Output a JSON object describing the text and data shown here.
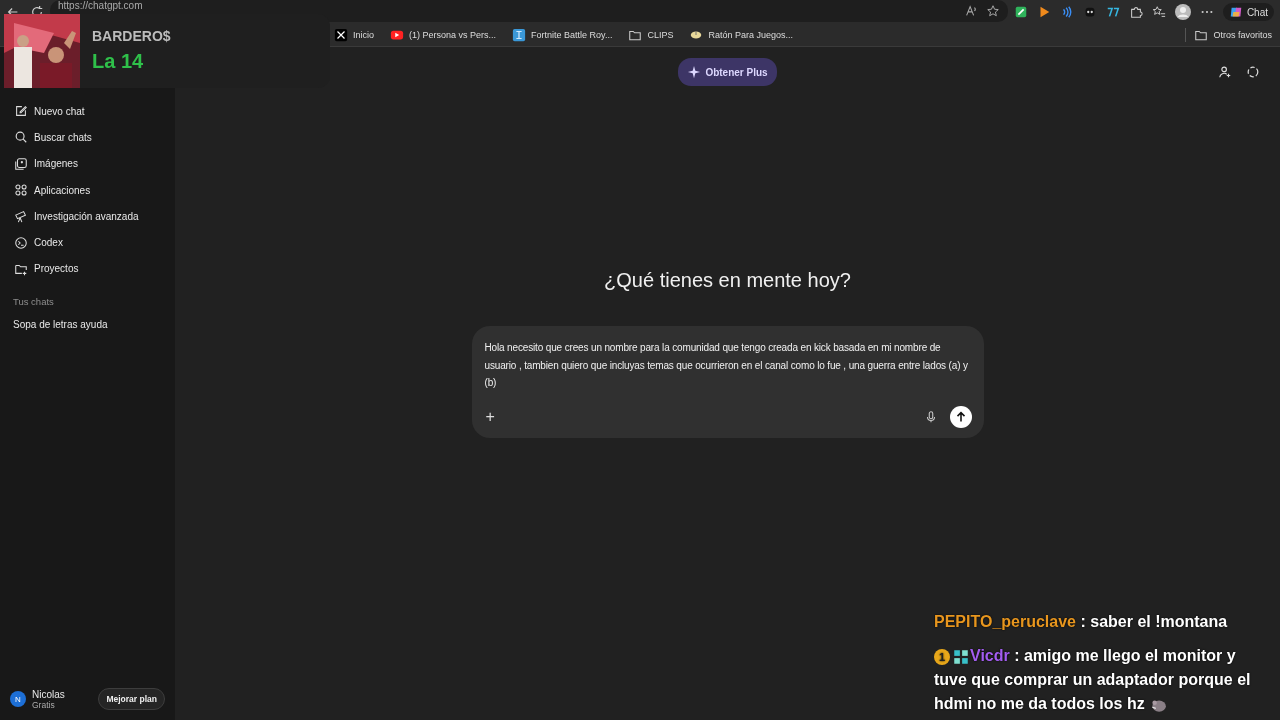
{
  "browser": {
    "url": "https://chatgpt.com",
    "copilot_label": "Chat",
    "bookmarks": [
      {
        "kind": "x",
        "label": "Inicio"
      },
      {
        "kind": "video",
        "label": "(1) Persona vs Pers..."
      },
      {
        "kind": "game",
        "label": "Fortnite Battle Roy..."
      },
      {
        "kind": "folder",
        "label": "CLIPS"
      },
      {
        "kind": "mouse",
        "label": "Ratón Para Juegos..."
      }
    ],
    "other_bookmarks": "Otros favoritos"
  },
  "stream_overlay": {
    "title": "BARDERO$",
    "subtitle": "La 14"
  },
  "sidebar": {
    "items": [
      {
        "kind": "edit",
        "label": "Nuevo chat"
      },
      {
        "kind": "search",
        "label": "Buscar chats"
      },
      {
        "kind": "images",
        "label": "Imágenes"
      },
      {
        "kind": "apps",
        "label": "Aplicaciones"
      },
      {
        "kind": "telescope",
        "label": "Investigación avanzada"
      },
      {
        "kind": "codex",
        "label": "Codex"
      },
      {
        "kind": "folder",
        "label": "Proyectos"
      }
    ],
    "section_title": "Tus chats",
    "chats": [
      {
        "label": "Sopa de letras ayuda"
      }
    ],
    "user": {
      "initial": "N",
      "name": "Nicolas",
      "plan": "Gratis"
    },
    "upgrade_button": "Mejorar plan"
  },
  "main": {
    "plus_button": "Obtener Plus",
    "heading": "¿Qué tienes en mente hoy?",
    "composer": {
      "value": "Hola necesito que crees un nombre para la comunidad que tengo creada en kick basada en mi nombre de usuario , tambien quiero que incluyas temas que ocurrieron en el canal como lo fue , una guerra entre lados (a) y (b)",
      "add_label": "+"
    }
  },
  "stream_chat": [
    {
      "user": "PEPITO_peruclave",
      "color": "#e8961e",
      "separator": ":",
      "message": "saber el !montana"
    },
    {
      "user": "Vicdr",
      "color": "#a35df0",
      "badges": [
        "1"
      ],
      "separator": ":",
      "message": "amigo me llego el monitor y tuve que comprar un adaptador porque el hdmi no me da todos los hz",
      "emote": true
    }
  ]
}
